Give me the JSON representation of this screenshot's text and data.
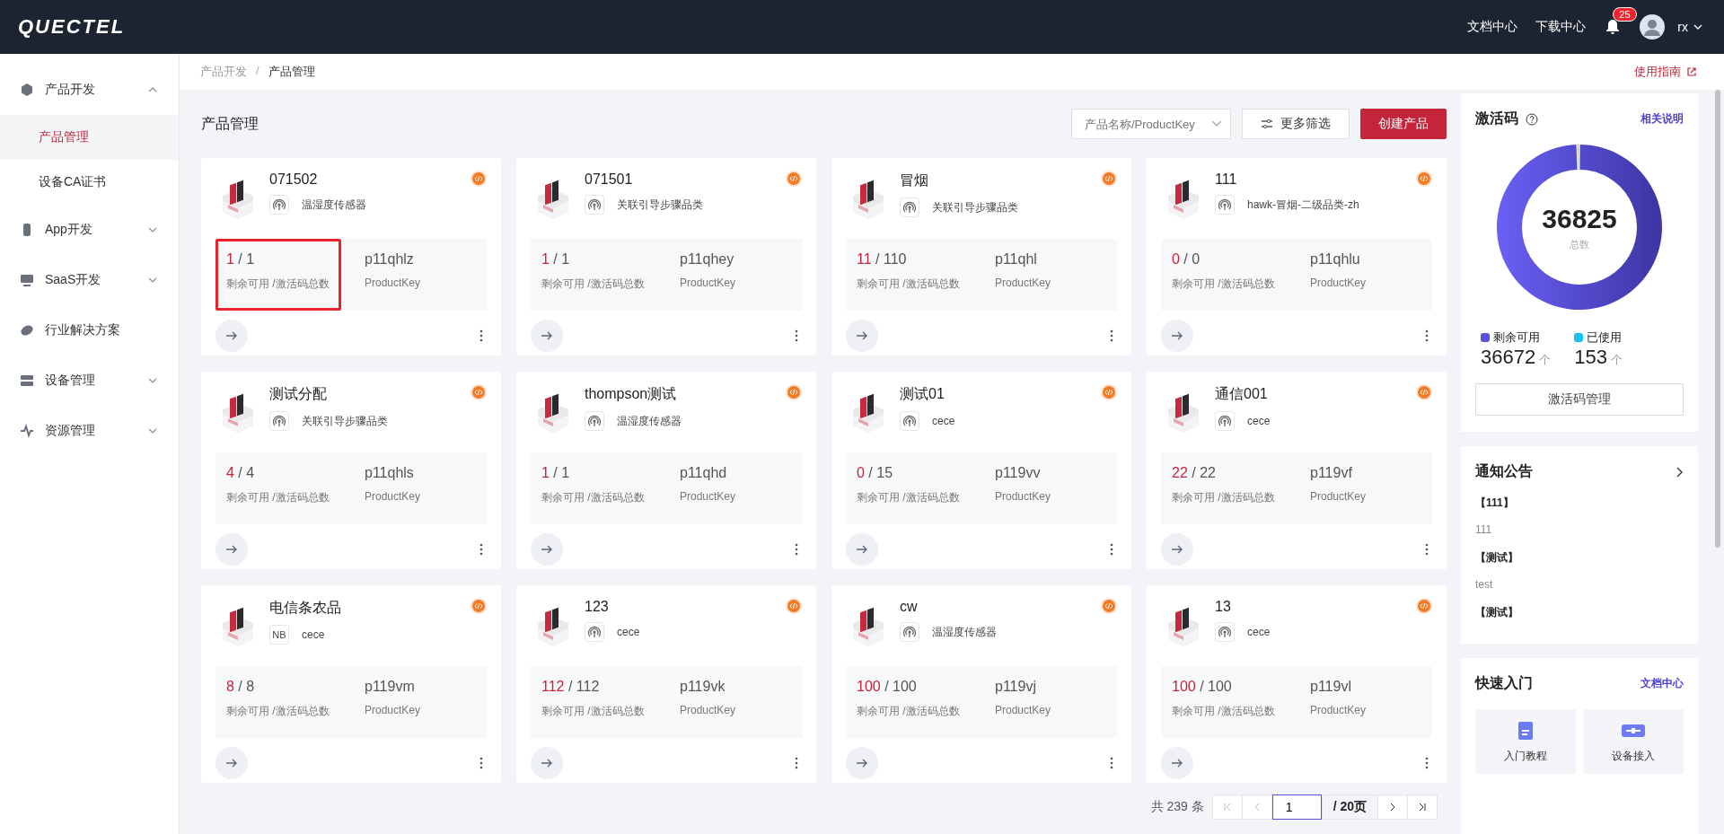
{
  "header": {
    "logo": "QUECTEL",
    "links": [
      "文档中心",
      "下载中心"
    ],
    "notifications": "25",
    "user": "rx"
  },
  "sidebar": {
    "items": [
      {
        "label": "产品开发",
        "expanded": true,
        "children": [
          {
            "label": "产品管理",
            "selected": true
          },
          {
            "label": "设备CA证书",
            "selected": false
          }
        ]
      },
      {
        "label": "App开发",
        "expanded": false
      },
      {
        "label": "SaaS开发",
        "expanded": false
      },
      {
        "label": "行业解决方案"
      },
      {
        "label": "设备管理",
        "expanded": false
      },
      {
        "label": "资源管理",
        "expanded": false
      }
    ]
  },
  "breadcrumb": [
    "产品开发",
    "产品管理"
  ],
  "breadcrumb_separator": "/",
  "guide_link": "使用指南",
  "page_title": "产品管理",
  "search": {
    "placeholder": "产品名称/ProductKey"
  },
  "filter_button": "更多筛选",
  "create_button": "创建产品",
  "products": [
    {
      "name": "071502",
      "tag": {
        "kind": "signal"
      },
      "category": "温湿度传感器",
      "remaining": "1",
      "total": "/ 1",
      "caption": "剩余可用 /激活码总数",
      "key": "p11qhlz",
      "key_caption": "ProductKey",
      "highlighted": true
    },
    {
      "name": "071501",
      "tag": {
        "kind": "signal"
      },
      "category": "关联引导步骤品类",
      "remaining": "1",
      "total": "/ 1",
      "caption": "剩余可用 /激活码总数",
      "key": "p11qhey",
      "key_caption": "ProductKey",
      "highlighted": false
    },
    {
      "name": "冒烟",
      "tag": {
        "kind": "signal"
      },
      "category": "关联引导步骤品类",
      "remaining": "11",
      "total": "/ 110",
      "caption": "剩余可用 /激活码总数",
      "key": "p11qhl",
      "key_caption": "ProductKey",
      "highlighted": false
    },
    {
      "name": "111",
      "tag": {
        "kind": "signal"
      },
      "category": "hawk-冒烟-二级品类-zh",
      "remaining": "0",
      "total": "/ 0",
      "caption": "剩余可用 /激活码总数",
      "key": "p11qhlu",
      "key_caption": "ProductKey",
      "highlighted": false
    },
    {
      "name": "测试分配",
      "tag": {
        "kind": "signal"
      },
      "category": "关联引导步骤品类",
      "remaining": "4",
      "total": "/ 4",
      "caption": "剩余可用 /激活码总数",
      "key": "p11qhls",
      "key_caption": "ProductKey",
      "highlighted": false
    },
    {
      "name": "thompson测试",
      "tag": {
        "kind": "signal"
      },
      "category": "温湿度传感器",
      "remaining": "1",
      "total": "/ 1",
      "caption": "剩余可用 /激活码总数",
      "key": "p11qhd",
      "key_caption": "ProductKey",
      "highlighted": false
    },
    {
      "name": "测试01",
      "tag": {
        "kind": "signal"
      },
      "category": "cece",
      "remaining": "0",
      "total": "/ 15",
      "caption": "剩余可用 /激活码总数",
      "key": "p119vv",
      "key_caption": "ProductKey",
      "highlighted": false
    },
    {
      "name": "通信001",
      "tag": {
        "kind": "signal"
      },
      "category": "cece",
      "remaining": "22",
      "total": "/ 22",
      "caption": "剩余可用 /激活码总数",
      "key": "p119vf",
      "key_caption": "ProductKey",
      "highlighted": false
    },
    {
      "name": "电信条农品",
      "tag": {
        "kind": "nb",
        "label": "NB"
      },
      "category": "cece",
      "remaining": "8",
      "total": "/ 8",
      "caption": "剩余可用 /激活码总数",
      "key": "p119vm",
      "key_caption": "ProductKey",
      "highlighted": false
    },
    {
      "name": "123",
      "tag": {
        "kind": "signal"
      },
      "category": "cece",
      "remaining": "112",
      "total": "/ 112",
      "caption": "剩余可用 /激活码总数",
      "key": "p119vk",
      "key_caption": "ProductKey",
      "highlighted": false
    },
    {
      "name": "cw",
      "tag": {
        "kind": "signal"
      },
      "category": "温湿度传感器",
      "remaining": "100",
      "total": "/ 100",
      "caption": "剩余可用 /激活码总数",
      "key": "p119vj",
      "key_caption": "ProductKey",
      "highlighted": false
    },
    {
      "name": "13",
      "tag": {
        "kind": "signal"
      },
      "category": "cece",
      "remaining": "100",
      "total": "/ 100",
      "caption": "剩余可用 /激活码总数",
      "key": "p119vl",
      "key_caption": "ProductKey",
      "highlighted": false
    }
  ],
  "pagination": {
    "total": "共 239 条",
    "page": "1",
    "pages": "/ 20页"
  },
  "activation": {
    "title": "激活码",
    "help_link": "相关说明",
    "total": "36825",
    "total_label": "总数",
    "legend": [
      {
        "label": "剩余可用",
        "color": "#5b4fe0",
        "value": "36672",
        "unit": "个"
      },
      {
        "label": "已使用",
        "color": "#17c3f2",
        "value": "153",
        "unit": "个"
      }
    ],
    "manage_button": "激活码管理"
  },
  "notices": {
    "title": "通知公告",
    "items": [
      {
        "title": "【111】",
        "body": "111"
      },
      {
        "title": "【测试】",
        "body": "test"
      },
      {
        "title": "【测试】"
      }
    ]
  },
  "quickstart": {
    "title": "快速入门",
    "link": "文档中心",
    "tiles": [
      {
        "label": "入门教程",
        "kind": "book"
      },
      {
        "label": "设备接入",
        "kind": "plug"
      }
    ]
  }
}
